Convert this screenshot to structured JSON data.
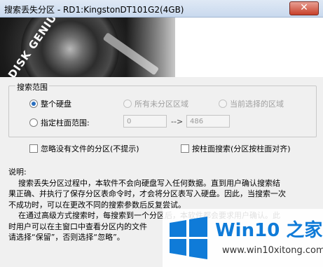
{
  "window": {
    "title": "搜索丢失分区 - RD1:KingstonDT101G2(4GB)",
    "close_glyph": "✕"
  },
  "banner": {
    "logo_text": "DISK GENIUS"
  },
  "search_range": {
    "title": "搜索范围",
    "options": [
      {
        "label": "整个硬盘",
        "checked": true,
        "enabled": true
      },
      {
        "label": "所有未分区区域",
        "checked": false,
        "enabled": false
      },
      {
        "label": "当前选择的区域",
        "checked": false,
        "enabled": false
      }
    ],
    "cylinder": {
      "label": "指定柱面范围:",
      "from": "0",
      "arrow": "-->",
      "to": "486"
    }
  },
  "checkboxes": {
    "ignore_no_files": "忽略没有文件的分区(不提示)",
    "search_by_cylinder": "按柱面搜索(分区按柱面对齐)"
  },
  "notes": {
    "heading": "说明:",
    "lines": [
      "    搜索丢失分区过程中，本软件不会向硬盘写入任何数据。直到用户确认搜索结",
      "果正确、并执行了保存分区表命令时，才会将分区表写入硬盘。因此，当搜索一次",
      "不成功时，可以在更改不同的搜索参数后反复尝试。",
      "    在通过高级方式搜索时，每搜索到一个分区后，本软件都会要求用户确认。此",
      "时用户可以在主窗口中查看分区内的文件",
      "请选择“保留”，否则选择“忽略”。"
    ]
  },
  "watermark": {
    "title": "Win10 之家",
    "url": "www.win10xitong.com",
    "logo_color": "#0f7bd8"
  }
}
